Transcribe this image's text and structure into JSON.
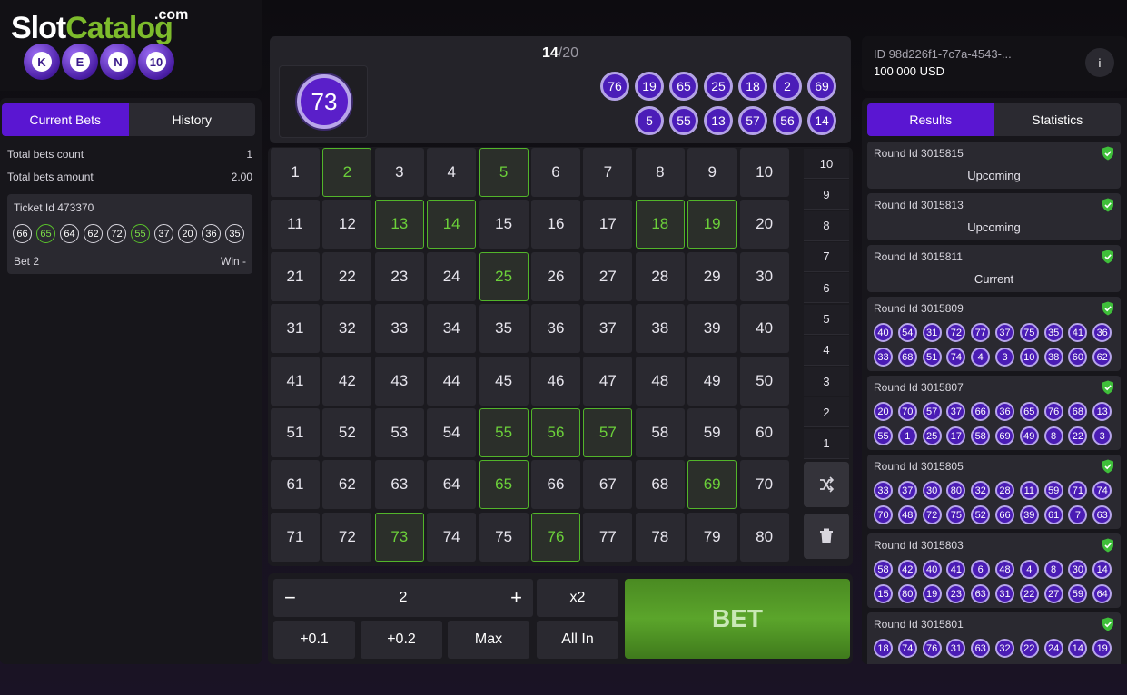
{
  "logo": {
    "brand_a": "Slot",
    "brand_b": "Catalog",
    "brand_c": ".com",
    "letters": [
      "K",
      "E",
      "N",
      "10"
    ]
  },
  "left": {
    "tabs": [
      {
        "label": "Current Bets",
        "active": true
      },
      {
        "label": "History",
        "active": false
      }
    ],
    "stats": [
      {
        "label": "Total bets count",
        "value": "1"
      },
      {
        "label": "Total bets amount",
        "value": "2.00"
      }
    ],
    "ticket": {
      "id_label": "Ticket Id 473370",
      "numbers": [
        66,
        65,
        64,
        62,
        72,
        55,
        37,
        20,
        36,
        35
      ],
      "hits": [
        65,
        55
      ],
      "bet_label": "Bet 2",
      "win_label": "Win -"
    }
  },
  "draw": {
    "count_current": "14",
    "count_total": "/20",
    "current_ball": "73",
    "drawn_row1": [
      76,
      19,
      65,
      25,
      18,
      2,
      69
    ],
    "drawn_row2": [
      5,
      55,
      13,
      57,
      56,
      14
    ]
  },
  "grid": {
    "numbers_total": 80,
    "hits": [
      2,
      5,
      13,
      14,
      18,
      19,
      25,
      55,
      56,
      57,
      65,
      69,
      73,
      76
    ],
    "pick_counts": [
      "10",
      "9",
      "8",
      "7",
      "6",
      "5",
      "4",
      "3",
      "2",
      "1"
    ],
    "tools": [
      "shuffle-icon",
      "trash-icon"
    ]
  },
  "controls": {
    "minus": "−",
    "stake": "2",
    "plus": "+",
    "multiplier": "x2",
    "quick": [
      "+0.1",
      "+0.2",
      "Max",
      "All In"
    ],
    "bet_label": "BET"
  },
  "account": {
    "id": "ID 98d226f1-7c7a-4543-...",
    "balance": "100 000 USD",
    "info": "i"
  },
  "right": {
    "tabs": [
      {
        "label": "Results",
        "active": true
      },
      {
        "label": "Statistics",
        "active": false
      }
    ],
    "rounds": [
      {
        "id": "Round Id 3015815",
        "status": "Upcoming"
      },
      {
        "id": "Round Id 3015813",
        "status": "Upcoming"
      },
      {
        "id": "Round Id 3015811",
        "status": "Current"
      },
      {
        "id": "Round Id 3015809",
        "balls": [
          40,
          54,
          31,
          72,
          77,
          37,
          75,
          35,
          41,
          36,
          33,
          68,
          51,
          74,
          4,
          3,
          10,
          38,
          60,
          62
        ]
      },
      {
        "id": "Round Id 3015807",
        "balls": [
          20,
          70,
          57,
          37,
          66,
          36,
          65,
          76,
          68,
          13,
          55,
          1,
          25,
          17,
          58,
          69,
          49,
          8,
          22,
          3
        ]
      },
      {
        "id": "Round Id 3015805",
        "balls": [
          33,
          37,
          30,
          80,
          32,
          28,
          11,
          59,
          71,
          74,
          70,
          48,
          72,
          75,
          52,
          66,
          39,
          61,
          7,
          63
        ]
      },
      {
        "id": "Round Id 3015803",
        "balls": [
          58,
          42,
          40,
          41,
          6,
          48,
          4,
          8,
          30,
          14,
          15,
          80,
          19,
          23,
          63,
          31,
          22,
          27,
          59,
          64
        ]
      },
      {
        "id": "Round Id 3015801",
        "balls": [
          18,
          74,
          76,
          31,
          63,
          32,
          22,
          24,
          14,
          19
        ]
      }
    ],
    "colors": {
      "accent": "#5a16d2",
      "hit": "#59c22b",
      "shield": "#3fbf3a"
    }
  }
}
